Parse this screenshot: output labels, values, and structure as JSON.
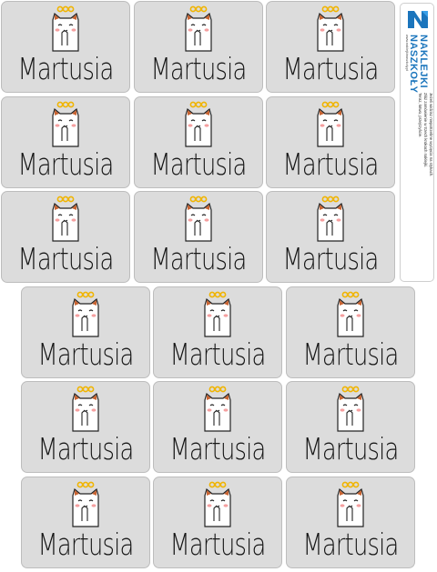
{
  "label": {
    "name": "Martusia"
  },
  "colors": {
    "sticker_bg": "#dcdcdc",
    "sticker_border": "#bdbdbd",
    "text": "#161616",
    "brand_blue": "#1b75bc",
    "halo": "#f0b400",
    "ear": "#c86432",
    "cheek": "#f5a0a0"
  },
  "stickers": [
    {
      "name": "Martusia"
    },
    {
      "name": "Martusia"
    },
    {
      "name": "Martusia"
    },
    {
      "name": "Martusia"
    },
    {
      "name": "Martusia"
    },
    {
      "name": "Martusia"
    },
    {
      "name": "Martusia"
    },
    {
      "name": "Martusia"
    },
    {
      "name": "Martusia"
    },
    {
      "name": "Martusia"
    },
    {
      "name": "Martusia"
    },
    {
      "name": "Martusia"
    },
    {
      "name": "Martusia"
    },
    {
      "name": "Martusia"
    },
    {
      "name": "Martusia"
    },
    {
      "name": "Martusia"
    },
    {
      "name": "Martusia"
    },
    {
      "name": "Martusia"
    }
  ],
  "brand_panel": {
    "logo_icon": "n-logo-icon",
    "brand_line1": "NAKLEJKI",
    "brand_line2": "NASZKOŁY",
    "description_line1": "Jeżeli widzisz niepotrzebne wycięcia na stykach.",
    "description_line2": "Złóż zamówienie w trzech krokach naklejki.",
    "description_line3": "Teraz, łatwo, przejrzyście.",
    "website": "www.naklejkinaszkoly.pl"
  }
}
